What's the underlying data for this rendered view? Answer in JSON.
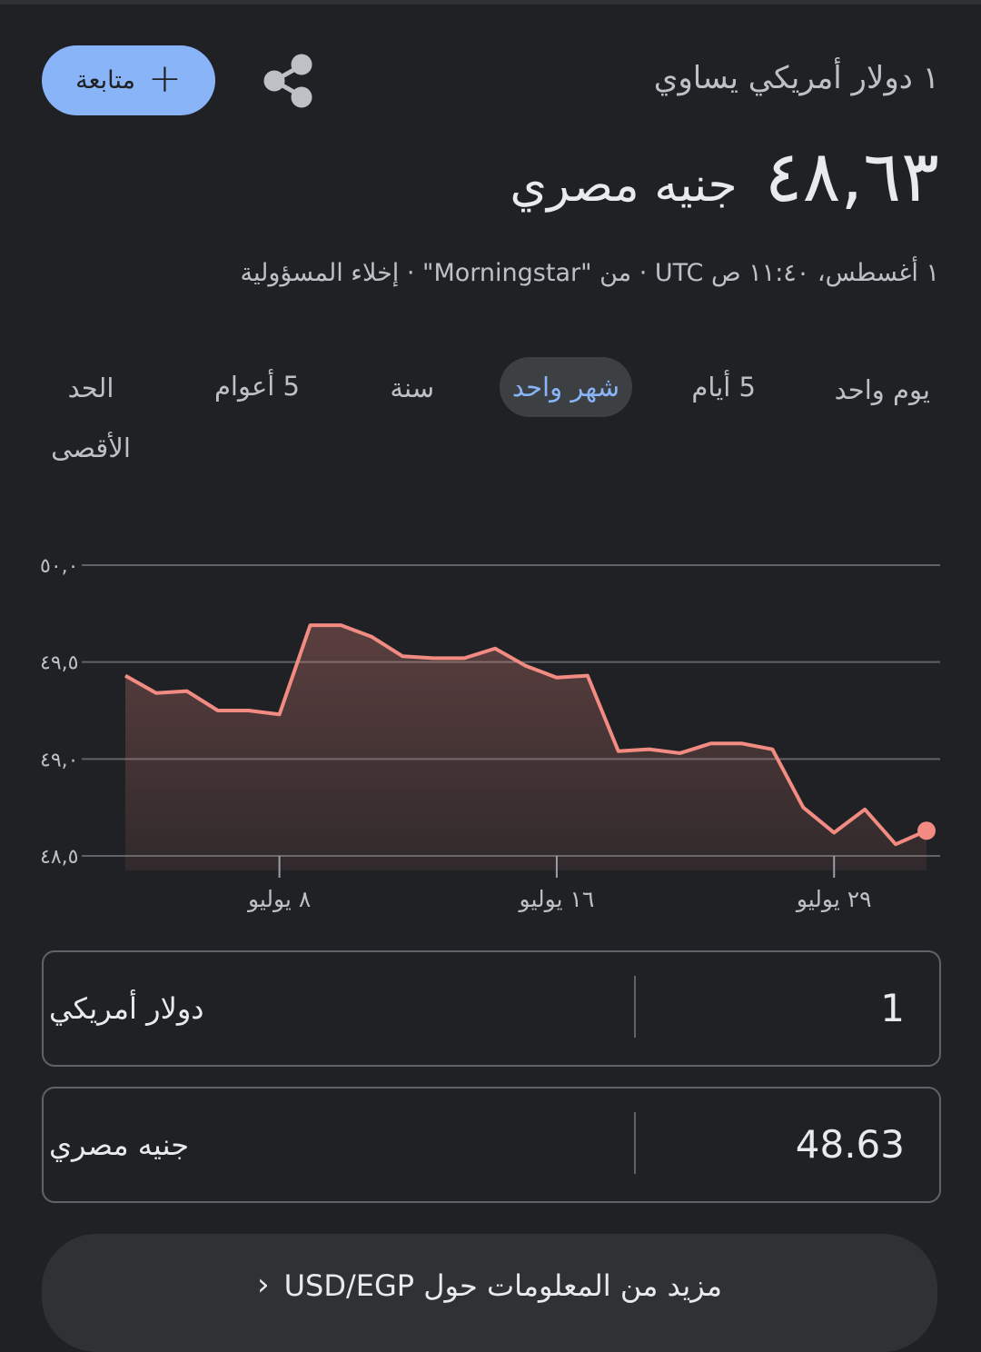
{
  "header": {
    "follow_label": "متابعة",
    "equals_text": "١ دولار أمريكي يساوي",
    "value": "٤٨,٦٣",
    "currency": "جنيه مصري",
    "meta": "١ أغسطس، ١١:٤٠ ص UTC · من \"Morningstar\" · إخلاء المسؤولية"
  },
  "tabs": [
    {
      "label": "يوم واحد"
    },
    {
      "label": "5 أيام"
    },
    {
      "label": "شهر واحد",
      "active": true
    },
    {
      "label": "سنة"
    },
    {
      "label": "5 أعوام"
    },
    {
      "label": "الحد الأقصى"
    }
  ],
  "colors": {
    "background": "#202124",
    "accent": "#8ab4f8",
    "line": "#f28b82",
    "grid": "#5f6368"
  },
  "icons": {
    "share": "share-icon",
    "plus": "plus-icon",
    "chevron": "chevron-left-icon"
  },
  "chart_data": {
    "type": "area",
    "ylim": [
      48.5,
      50.0
    ],
    "y_ticks": [
      "٤٨,٥",
      "٤٩,٠",
      "٤٩,٥",
      "٥٠,٠"
    ],
    "y_tick_values": [
      48.5,
      49.0,
      49.5,
      50.0
    ],
    "x_ticks": [
      "٨ يوليو",
      "١٦ يوليو",
      "٢٩ يوليو"
    ],
    "x_tick_index": [
      5,
      14,
      23
    ],
    "values": [
      49.43,
      49.34,
      49.35,
      49.25,
      49.25,
      49.23,
      49.69,
      49.69,
      49.63,
      49.53,
      49.52,
      49.52,
      49.57,
      49.48,
      49.42,
      49.43,
      49.04,
      49.05,
      49.03,
      49.08,
      49.08,
      49.05,
      48.75,
      48.62,
      48.74,
      48.56,
      48.63
    ],
    "grid": true,
    "last_point_marker": true
  },
  "converter": {
    "from": {
      "value": "1",
      "unit": "دولار أمريكي"
    },
    "to": {
      "value": "48.63",
      "unit": "جنيه مصري"
    }
  },
  "more": {
    "label": "مزيد من المعلومات حول USD/EGP"
  }
}
